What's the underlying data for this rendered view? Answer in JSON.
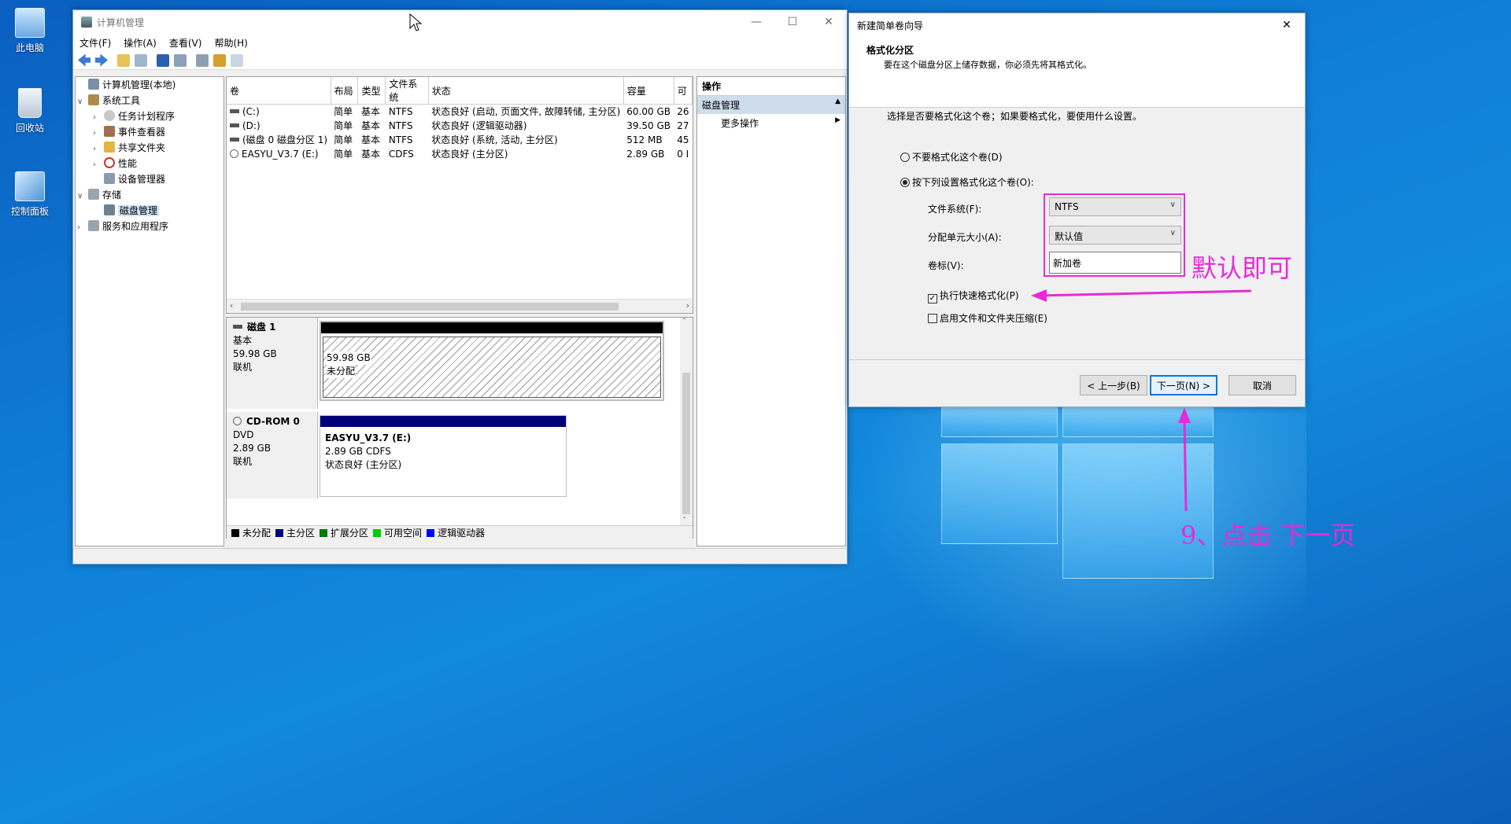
{
  "desktop": {
    "icons": [
      {
        "label": "此电脑",
        "icon": "computer-icon"
      },
      {
        "label": "回收站",
        "icon": "recycle-bin-icon"
      },
      {
        "label": "控制面板",
        "icon": "control-panel-icon"
      }
    ]
  },
  "mmc": {
    "title": "计算机管理",
    "menu": [
      "文件(F)",
      "操作(A)",
      "查看(V)",
      "帮助(H)"
    ],
    "tree": {
      "root": "计算机管理(本地)",
      "system_tools": "系统工具",
      "task_scheduler": "任务计划程序",
      "event_viewer": "事件查看器",
      "shared_folders": "共享文件夹",
      "performance": "性能",
      "device_manager": "设备管理器",
      "storage": "存储",
      "disk_management": "磁盘管理",
      "services_apps": "服务和应用程序"
    },
    "columns": [
      "卷",
      "布局",
      "类型",
      "文件系统",
      "状态",
      "容量",
      "可"
    ],
    "volumes": [
      {
        "vol": "(C:)",
        "layout": "简单",
        "type": "基本",
        "fs": "NTFS",
        "status": "状态良好 (启动, 页面文件, 故障转储, 主分区)",
        "capacity": "60.00 GB",
        "free": "26"
      },
      {
        "vol": "(D:)",
        "layout": "简单",
        "type": "基本",
        "fs": "NTFS",
        "status": "状态良好 (逻辑驱动器)",
        "capacity": "39.50 GB",
        "free": "27"
      },
      {
        "vol": "(磁盘 0 磁盘分区 1)",
        "layout": "简单",
        "type": "基本",
        "fs": "NTFS",
        "status": "状态良好 (系统, 活动, 主分区)",
        "capacity": "512 MB",
        "free": "45"
      },
      {
        "vol": "EASYU_V3.7 (E:)",
        "layout": "简单",
        "type": "基本",
        "fs": "CDFS",
        "status": "状态良好 (主分区)",
        "capacity": "2.89 GB",
        "free": "0 I"
      }
    ],
    "disk1": {
      "name": "磁盘 1",
      "type": "基本",
      "size": "59.98 GB",
      "state": "联机",
      "part_size": "59.98 GB",
      "part_status": "未分配"
    },
    "cdrom": {
      "name": "CD-ROM 0",
      "type": "DVD",
      "size": "2.89 GB",
      "state": "联机",
      "part_name": "EASYU_V3.7  (E:)",
      "part_size": "2.89 GB CDFS",
      "part_status": "状态良好 (主分区)"
    },
    "legend": [
      {
        "label": "未分配",
        "color": "#000000"
      },
      {
        "label": "主分区",
        "color": "#00007a"
      },
      {
        "label": "扩展分区",
        "color": "#007a00"
      },
      {
        "label": "可用空间",
        "color": "#00cc00"
      },
      {
        "label": "逻辑驱动器",
        "color": "#0000ff"
      }
    ],
    "actions": {
      "header": "操作",
      "section": "磁盘管理",
      "more": "更多操作"
    }
  },
  "wizard": {
    "title": "新建简单卷向导",
    "heading": "格式化分区",
    "subheading": "要在这个磁盘分区上储存数据，你必须先将其格式化。",
    "prompt": "选择是否要格式化这个卷；如果要格式化，要使用什么设置。",
    "opt_no_format": "不要格式化这个卷(D)",
    "opt_format": "按下列设置格式化这个卷(O):",
    "fs_label": "文件系统(F):",
    "fs_value": "NTFS",
    "alloc_label": "分配单元大小(A):",
    "alloc_value": "默认值",
    "vol_label": "卷标(V):",
    "vol_value": "新加卷",
    "quick_format": "执行快速格式化(P)",
    "quick_format_checked": true,
    "compression": "启用文件和文件夹压缩(E)",
    "back": "< 上一步(B)",
    "next": "下一页(N) >",
    "cancel": "取消"
  },
  "annotations": {
    "default_ok": "默认即可",
    "click_next": "9、点击 下一页",
    "color": "#e82ad8"
  }
}
